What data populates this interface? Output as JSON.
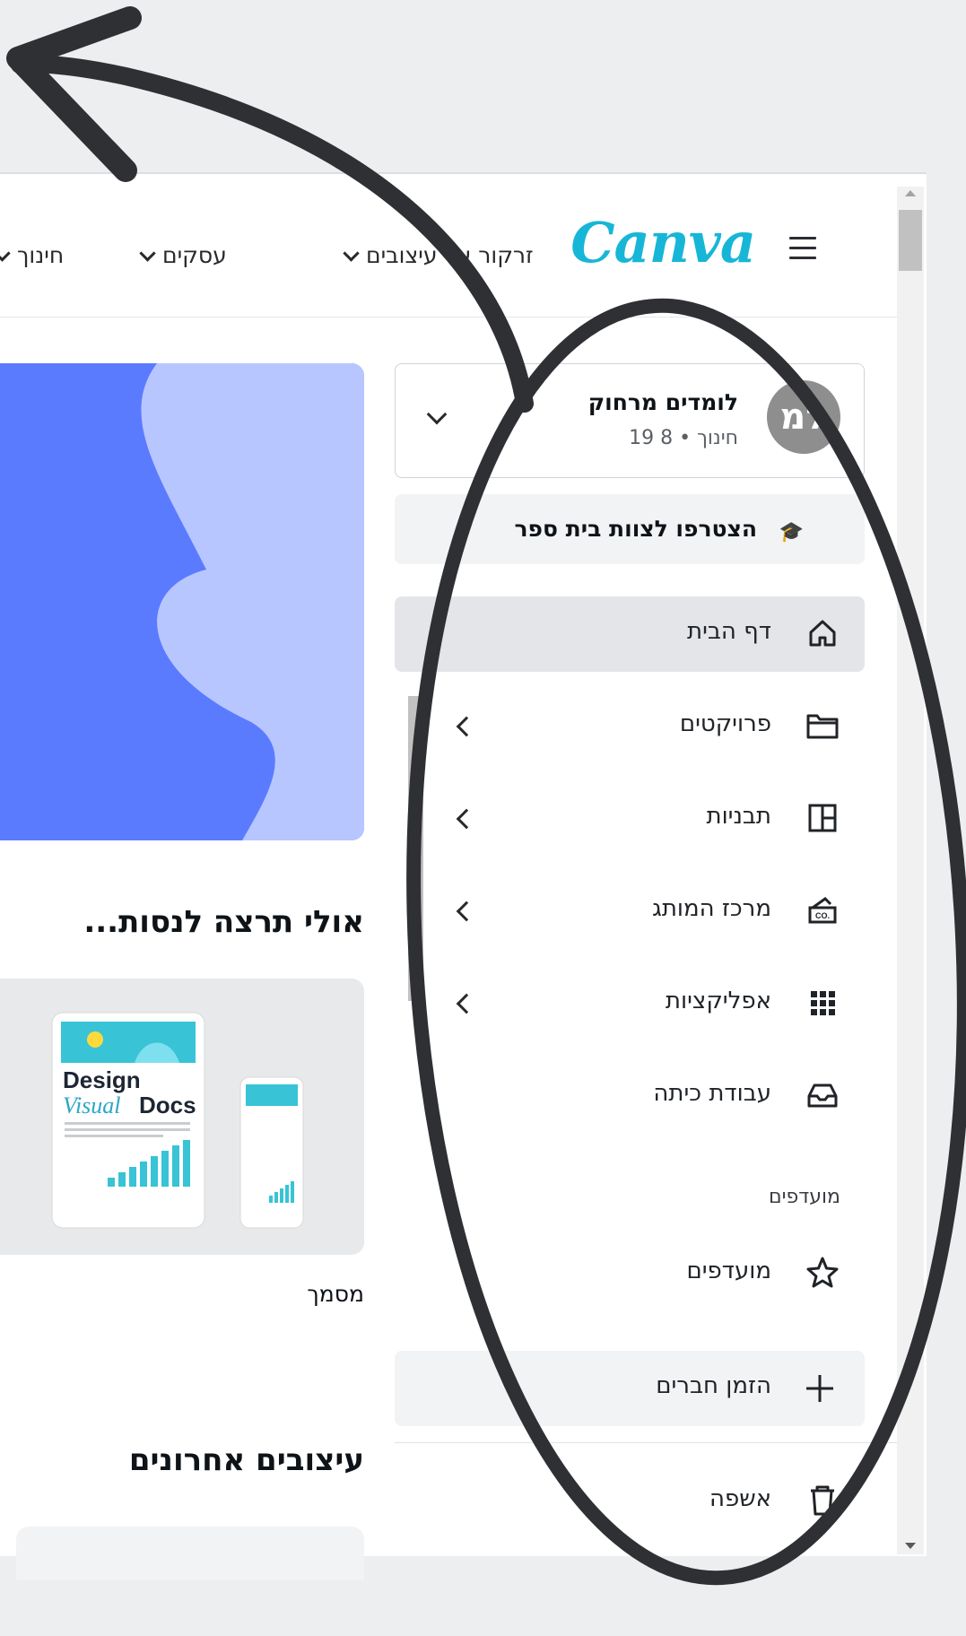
{
  "header": {
    "logo": "Canva",
    "nav": [
      {
        "label": "זרקור על עיצובים"
      },
      {
        "label": "עסקים"
      },
      {
        "label": "חינוך"
      }
    ]
  },
  "account": {
    "initials": "למ",
    "name": "לומדים מרחוק",
    "meta": "חינוך • 8 19"
  },
  "join_banner": "הצטרפו לצוות בית ספר",
  "sidebar": {
    "items": [
      {
        "label": "דף הבית",
        "icon": "home-icon"
      },
      {
        "label": "פרויקטים",
        "icon": "folder-icon"
      },
      {
        "label": "תבניות",
        "icon": "template-icon"
      },
      {
        "label": "מרכז המותג",
        "icon": "brand-icon"
      },
      {
        "label": "אפליקציות",
        "icon": "apps-grid-icon"
      },
      {
        "label": "עבודת כיתה",
        "icon": "inbox-icon"
      }
    ],
    "favorites_title": "מועדפים",
    "favorites_item": "מועדפים",
    "invite": "הזמן חברים",
    "trash": "אשפה"
  },
  "main": {
    "suggest_heading": "אולי תרצה לנסות...",
    "card_title_1": "Design",
    "card_title_2": "Visual",
    "card_title_3": "Docs",
    "card_label": "מסמך",
    "recent_heading": "עיצובים אחרונים"
  },
  "colors": {
    "logo": "#17b6d6",
    "hero_dark": "#5b7bff",
    "hero_light": "#b8c6ff",
    "annotation": "#2f3033"
  }
}
